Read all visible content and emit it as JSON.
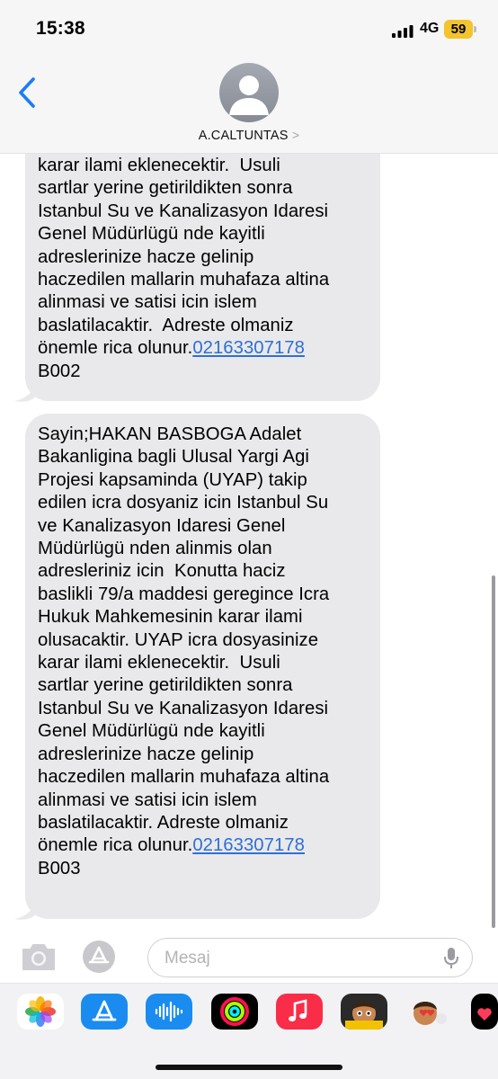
{
  "status_bar": {
    "time": "15:38",
    "network": "4G",
    "battery": "59",
    "battery_color": "#f3c42b"
  },
  "header": {
    "contact_name": "A.CALTUNTAS",
    "chevron": ">",
    "back_icon": "chevron-left-icon",
    "avatar_icon": "person-silhouette-icon",
    "accent": "#1c7cf5"
  },
  "messages": [
    {
      "lines": [
        "karar ilami eklenecektir.  Usuli",
        "sartlar yerine getirildikten sonra",
        "Istanbul Su ve Kanalizasyon Idaresi",
        "Genel Müdürlügü nde kayitli",
        "adreslerinize hacze gelinip",
        "haczedilen mallarin muhafaza altina",
        "alinmasi ve satisi icin islem",
        "baslatilacaktir.  Adreste olmaniz",
        "önemle rica olunur."
      ],
      "phone": "02163307178",
      "code": "B002"
    },
    {
      "lines": [
        "Sayin;HAKAN BASBOGA Adalet",
        "Bakanligina bagli Ulusal Yargi Agi",
        "Projesi kapsaminda (UYAP) takip",
        "edilen icra dosyaniz icin Istanbul Su",
        "ve Kanalizasyon Idaresi Genel",
        "Müdürlügü nden alinmis olan",
        "adresleriniz icin  Konutta haciz",
        "baslikli 79/a maddesi geregince Icra",
        "Hukuk Mahkemesinin karar ilami",
        "olusacaktir. UYAP icra dosyasinize",
        "karar ilami eklenecektir.  Usuli",
        "sartlar yerine getirildikten sonra",
        "Istanbul Su ve Kanalizasyon Idaresi",
        "Genel Müdürlügü nde kayitli",
        "adreslerinize hacze gelinip",
        "haczedilen mallarin muhafaza altina",
        "alinmasi ve satisi icin islem",
        "baslatilacaktir. Adreste olmaniz",
        "önemle rica olunur."
      ],
      "phone": "02163307178",
      "code": "B003"
    }
  ],
  "input_bar": {
    "placeholder": "Mesaj",
    "camera_icon": "camera-icon",
    "apps_icon": "app-store-icon",
    "mic_icon": "microphone-icon"
  },
  "app_drawer": {
    "apps": [
      "photos-icon",
      "app-store-icon",
      "audio-message-icon",
      "activity-icon",
      "music-icon",
      "memoji-icon",
      "memoji-stickers-icon",
      "digital-touch-icon"
    ]
  }
}
